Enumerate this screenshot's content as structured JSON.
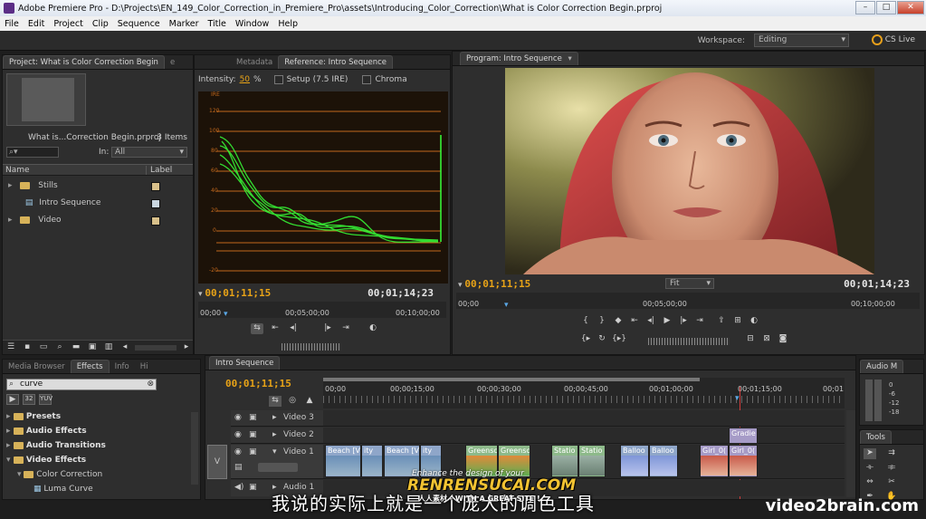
{
  "window": {
    "title": "Adobe Premiere Pro - D:\\Projects\\EN_149_Color_Correction_in_Premiere_Pro\\assets\\Introducing_Color_Correction\\What is Color Correction Begin.prproj"
  },
  "menu": [
    "File",
    "Edit",
    "Project",
    "Clip",
    "Sequence",
    "Marker",
    "Title",
    "Window",
    "Help"
  ],
  "workspace": {
    "label": "Workspace:",
    "value": "Editing",
    "cslive": "CS Live"
  },
  "project_panel": {
    "tabs": [
      "Project: What is Color Correction Begin",
      "e",
      "Metadata"
    ],
    "filename": "What is...Correction Begin.prproj",
    "item_count": "3 Items",
    "in_label": "In:",
    "in_value": "All",
    "col_name": "Name",
    "col_label": "Label",
    "items": [
      {
        "name": "Stills",
        "type": "folder",
        "label_color": "#d8c08a"
      },
      {
        "name": "Intro Sequence",
        "type": "sequence",
        "label_color": "#c9d6e0"
      },
      {
        "name": "Video",
        "type": "folder",
        "label_color": "#d8c08a"
      }
    ]
  },
  "reference_monitor": {
    "tab": "Reference: Intro Sequence",
    "intensity_label": "Intensity:",
    "intensity_value": "50",
    "intensity_unit": "%",
    "setup_label": "Setup (7.5 IRE)",
    "chroma_label": "Chroma",
    "ire_label": "IRE",
    "scale": [
      "120",
      "100",
      "80",
      "60",
      "40",
      "20",
      "0",
      "-20"
    ],
    "timecode_current": "00;01;11;15",
    "timecode_duration": "00;01;14;23",
    "ruler": [
      "00;00",
      "00;05;00;00",
      "00;10;00;00"
    ]
  },
  "program_monitor": {
    "tab": "Program: Intro Sequence",
    "fit": "Fit",
    "timecode_current": "00;01;11;15",
    "timecode_duration": "00;01;14;23",
    "ruler": [
      "00;00",
      "00;05;00;00",
      "00;10;00;00"
    ]
  },
  "effects_panel": {
    "tabs": [
      "Media Browser",
      "Effects",
      "Info",
      "Hi"
    ],
    "search_value": "curve",
    "tree": [
      {
        "label": "Presets",
        "level": 0
      },
      {
        "label": "Audio Effects",
        "level": 0
      },
      {
        "label": "Audio Transitions",
        "level": 0
      },
      {
        "label": "Video Effects",
        "level": 0
      },
      {
        "label": "Color Correction",
        "level": 1
      },
      {
        "label": "Luma Curve",
        "level": 2
      }
    ]
  },
  "timeline": {
    "tab": "Intro Sequence",
    "timecode": "00;01;11;15",
    "ruler": [
      "00;00",
      "00;00;15;00",
      "00;00;30;00",
      "00;00;45;00",
      "00;01;00;00",
      "00;01;15;00",
      "00;01"
    ],
    "tracks": [
      "Video 3",
      "Video 2",
      "Video 1",
      "Audio 1"
    ],
    "v_label": "V",
    "clips_v1": [
      {
        "label": "Beach [V]",
        "color": "#8fa6c9"
      },
      {
        "label": "ity",
        "color": "#8fa6c9"
      },
      {
        "label": "Beach [V]",
        "color": "#8fa6c9"
      },
      {
        "label": "ity",
        "color": "#8fa6c9"
      },
      {
        "label": "Greensc",
        "color": "#8db98a"
      },
      {
        "label": "Greensc",
        "color": "#8db98a"
      },
      {
        "label": "Statio",
        "color": "#8db98a"
      },
      {
        "label": "Statio",
        "color": "#8db98a"
      },
      {
        "label": "Balloo",
        "color": "#8fa6c9"
      },
      {
        "label": "Balloo",
        "color": "#8fa6c9"
      },
      {
        "label": "Girl_0(",
        "color": "#a69bc7"
      },
      {
        "label": "Girl_0(",
        "color": "#a69bc7"
      }
    ],
    "clip_v2": {
      "label": "Gradie",
      "color": "#a69bc7"
    }
  },
  "audio_meters": {
    "tab": "Audio M",
    "scale": [
      "0",
      "-6",
      "-12",
      "-18"
    ]
  },
  "tools": {
    "tab": "Tools"
  },
  "overlay": {
    "subtitle": "我说的实际上就是一个庞大的调色工具",
    "watermark_line1": "Enhance the design of your",
    "watermark_brand": "RENRENSUCAI.COM",
    "watermark_line3": "人人素材 - WITH A GREAT SITE !",
    "corner": "video2brain.com"
  }
}
